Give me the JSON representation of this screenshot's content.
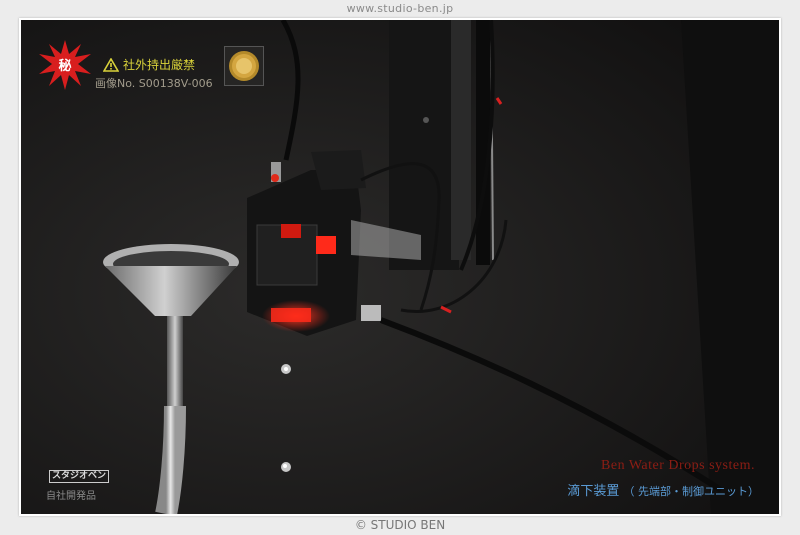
{
  "header": {
    "url": "www.studio-ben.jp"
  },
  "footer": {
    "copyright": "© STUDIO BEN"
  },
  "overlay": {
    "warning_text": "社外持出厳禁",
    "image_number": "画像No. S00138V-006",
    "secret_seal_char": "秘",
    "brand_logo_text": "スタジオベン",
    "in_house_text": "自社開発品",
    "title_en": "Ben Water Drops system.",
    "title_jp": "滴下装置",
    "title_jp_sub": "（ 先端部・制御ユニット）"
  },
  "colors": {
    "background": "#1e1d1d",
    "seal_red": "#d81e1e",
    "warning_yellow": "#d9d23a",
    "title_red": "#8b1d14",
    "title_blue": "#5a9bd5",
    "led_red": "#ff2a1a"
  }
}
